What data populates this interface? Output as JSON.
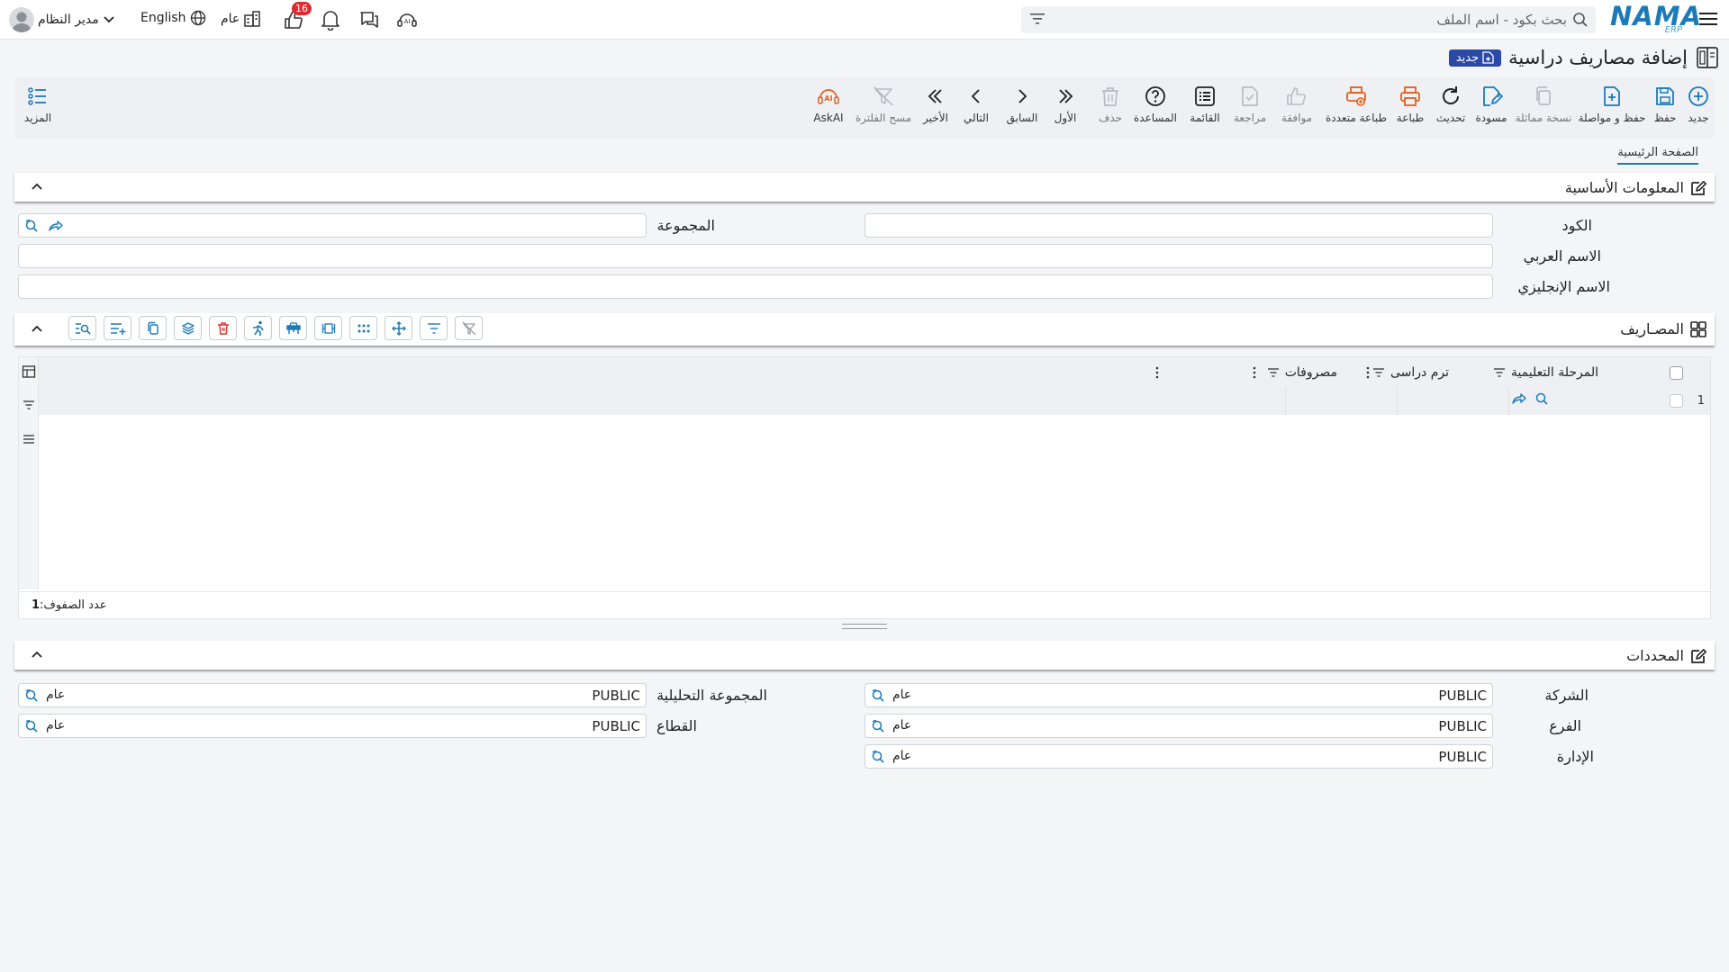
{
  "topbar": {
    "logo": "NAMA",
    "logo_sub": "ERP",
    "search_placeholder": "بحث بكود - اسم الملف",
    "notifications_count": "16",
    "public_label": "عام",
    "language": "English",
    "user_name": "مدير النظام"
  },
  "page": {
    "title": "إضافة مصاريف دراسية",
    "new_badge": "جديد"
  },
  "toolbar": {
    "new": "جديد",
    "save": "حفظ",
    "save_continue": "حفظ و مواصلة",
    "duplicate": "نسخة مماثلة",
    "draft": "مسودة",
    "refresh": "تحديث",
    "print": "طباعة",
    "multi_print": "طباعة متعددة",
    "approve": "موافقة",
    "review": "مراجعة",
    "list": "القائمة",
    "help": "المساعدة",
    "delete": "حذف",
    "first": "الأول",
    "previous": "السابق",
    "next": "التالي",
    "last": "الأخير",
    "clear_filter": "مسح الفلترة",
    "askai": "AskAI",
    "more": "المزيد"
  },
  "tabs": {
    "main": "الصفحة الرئيسية"
  },
  "basic_info": {
    "title": "المعلومات الأساسية",
    "code_label": "الكود",
    "group_label": "المجموعة",
    "arabic_name_label": "الاسم العربي",
    "english_name_label": "الاسم الإنجليزي"
  },
  "expenses": {
    "title": "المصـاريف",
    "columns": [
      "المرحلة التعليمية",
      "ترم دراسى",
      "مصروفات"
    ],
    "rows": [
      {
        "num": "1"
      }
    ],
    "row_count_label": "عدد الصفوف:",
    "row_count": "1"
  },
  "dimensions": {
    "title": "المحددات",
    "company_label": "الشركة",
    "branch_label": "الفرع",
    "department_label": "الإدارة",
    "analytic_group_label": "المجموعة التحليلية",
    "sector_label": "القطاع",
    "company_value": "PUBLIC",
    "branch_value": "PUBLIC",
    "department_value": "PUBLIC",
    "analytic_group_value": "PUBLIC",
    "sector_value": "PUBLIC",
    "tag": "عام"
  },
  "colors": {
    "accent": "#1c7ab8",
    "orange": "#e0601e",
    "badge_red": "#e0282e",
    "new_blue": "#2b4aa8"
  }
}
